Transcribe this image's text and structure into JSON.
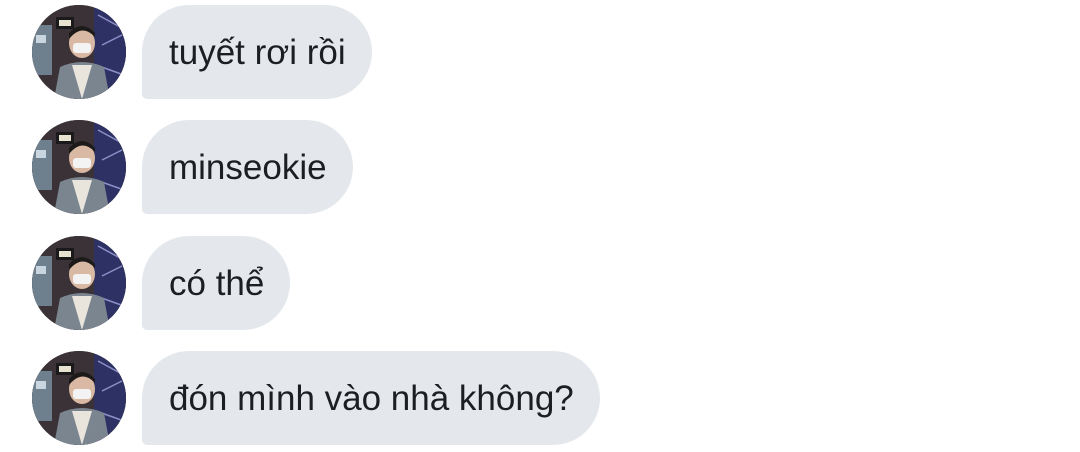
{
  "conversation": {
    "messages": [
      {
        "text": "tuyết rơi rồi",
        "avatar_icon": "user-avatar-icon"
      },
      {
        "text": "minseokie",
        "avatar_icon": "user-avatar-icon"
      },
      {
        "text": "có thể",
        "avatar_icon": "user-avatar-icon"
      },
      {
        "text": "đón mình vào nhà không?",
        "avatar_icon": "user-avatar-icon"
      }
    ]
  },
  "colors": {
    "bubble_background": "#e4e8ed",
    "bubble_text": "#1c1e21",
    "page_background": "#ffffff"
  }
}
